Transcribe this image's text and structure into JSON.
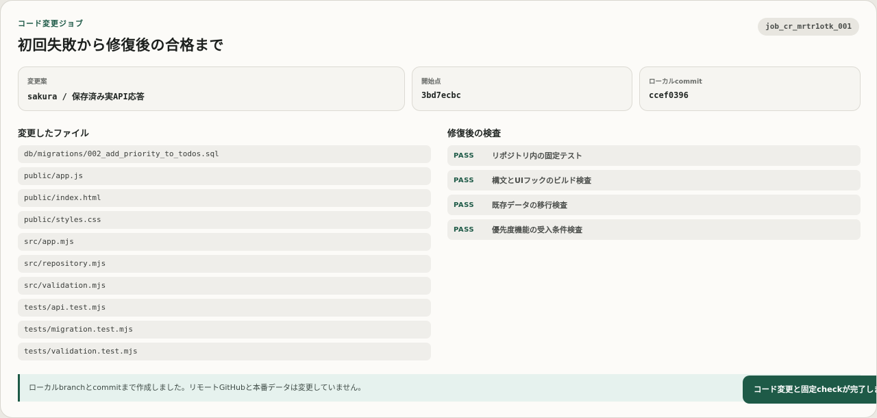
{
  "header": {
    "eyebrow": "コード変更ジョブ",
    "title": "初回失敗から修復後の合格まで",
    "job_id": "job_cr_mrtr1otk_001"
  },
  "info_cards": [
    {
      "label": "変更案",
      "value": "sakura / 保存済み実API応答"
    },
    {
      "label": "開始点",
      "value": "3bd7ecbc"
    },
    {
      "label": "ローカルcommit",
      "value": "ccef0396"
    }
  ],
  "files_section": {
    "title": "変更したファイル",
    "items": [
      "db/migrations/002_add_priority_to_todos.sql",
      "public/app.js",
      "public/index.html",
      "public/styles.css",
      "src/app.mjs",
      "src/repository.mjs",
      "src/validation.mjs",
      "tests/api.test.mjs",
      "tests/migration.test.mjs",
      "tests/validation.test.mjs"
    ]
  },
  "checks_section": {
    "title": "修復後の検査",
    "items": [
      {
        "status": "PASS",
        "label": "リポジトリ内の固定テスト"
      },
      {
        "status": "PASS",
        "label": "構文とUIフックのビルド検査"
      },
      {
        "status": "PASS",
        "label": "既存データの移行検査"
      },
      {
        "status": "PASS",
        "label": "優先度機能の受入条件検査"
      }
    ]
  },
  "notice": "ローカルbranchとcommitまで作成しました。リモートGitHubと本番データは変更していません。",
  "toast": "コード変更と固定checkが完了しました"
}
